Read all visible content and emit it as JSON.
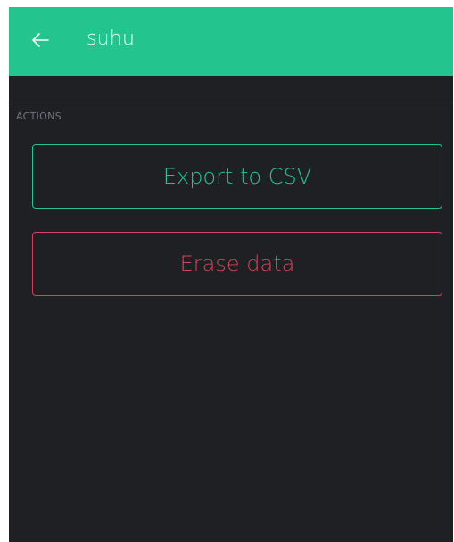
{
  "header": {
    "title": "suhu",
    "back_icon": "arrow-left-icon",
    "background_color": "#23c48e"
  },
  "sections": {
    "actions_label": "ACTIONS"
  },
  "actions": {
    "export_label": "Export to CSV",
    "erase_label": "Erase data"
  },
  "colors": {
    "accent": "#23c48e",
    "danger": "#d3435c",
    "background": "#1f2024"
  }
}
